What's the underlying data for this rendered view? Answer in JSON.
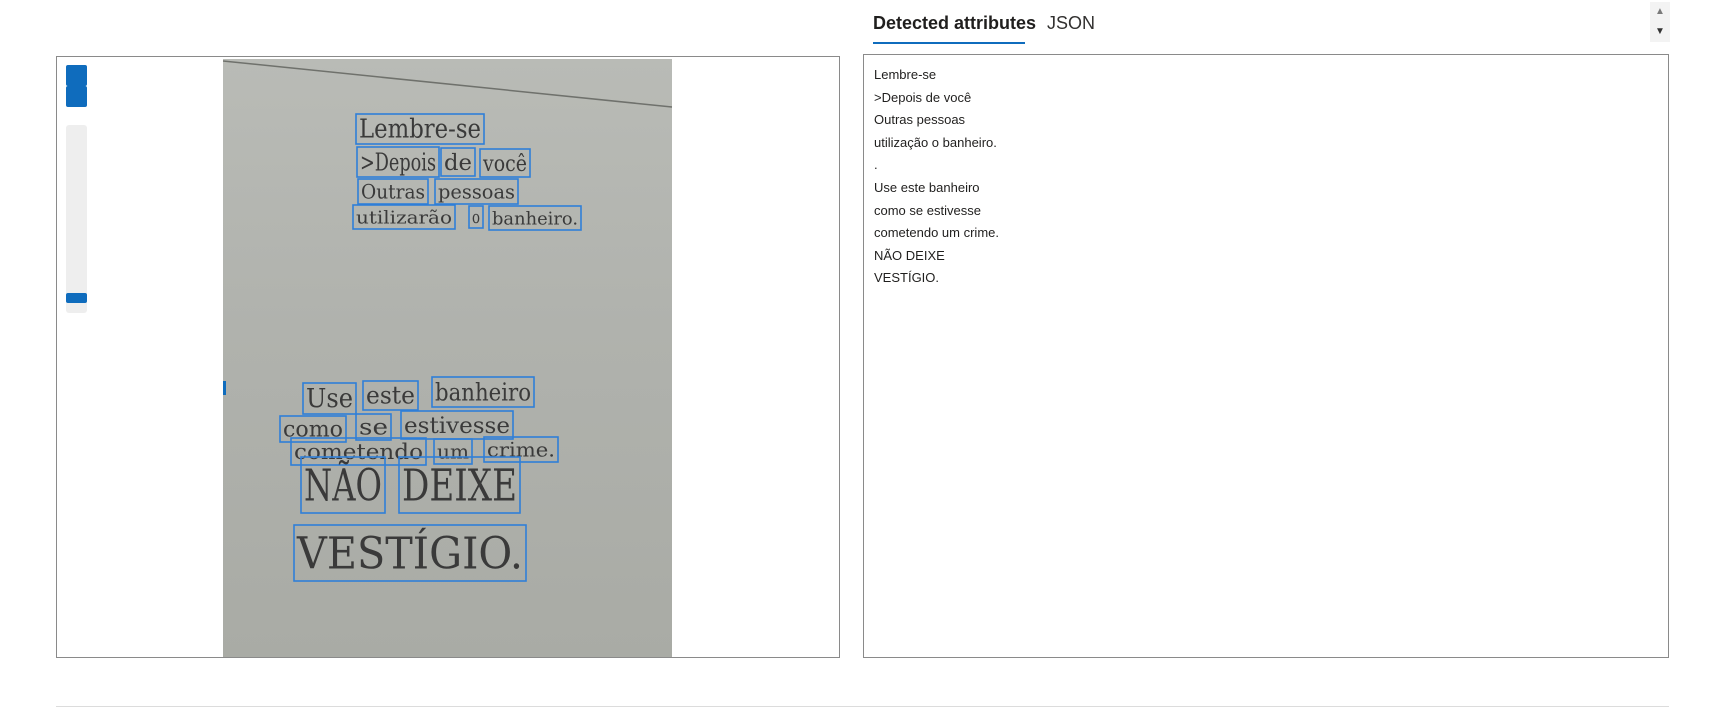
{
  "tabs": {
    "detected_label": "Detected attributes",
    "json_label": "JSON"
  },
  "scroll": {
    "up_glyph": "▲",
    "down_glyph": "▼"
  },
  "detected_lines": [
    "Lembre-se",
    ">Depois de você",
    "Outras pessoas",
    "utilização o banheiro.",
    ".",
    "Use este banheiro",
    "como se estivesse",
    "cometendo um crime.",
    "NÃO DEIXE",
    "VESTÍGIO."
  ],
  "photo_words": [
    "Lembre-se",
    ">Depois",
    "de",
    "você",
    "Outras",
    "pessoas",
    "utilizarão",
    "o",
    "banheiro.",
    "Use",
    "este",
    "banheiro",
    "como",
    "se",
    "estivesse",
    "cometendo",
    "um",
    "crime.",
    "NÃO",
    "DEIXE",
    "VESTÍGIO."
  ],
  "colors": {
    "accent": "#0f6cbd",
    "box_border": "#2f7fd8",
    "handwriting": "#3a3a3a"
  }
}
